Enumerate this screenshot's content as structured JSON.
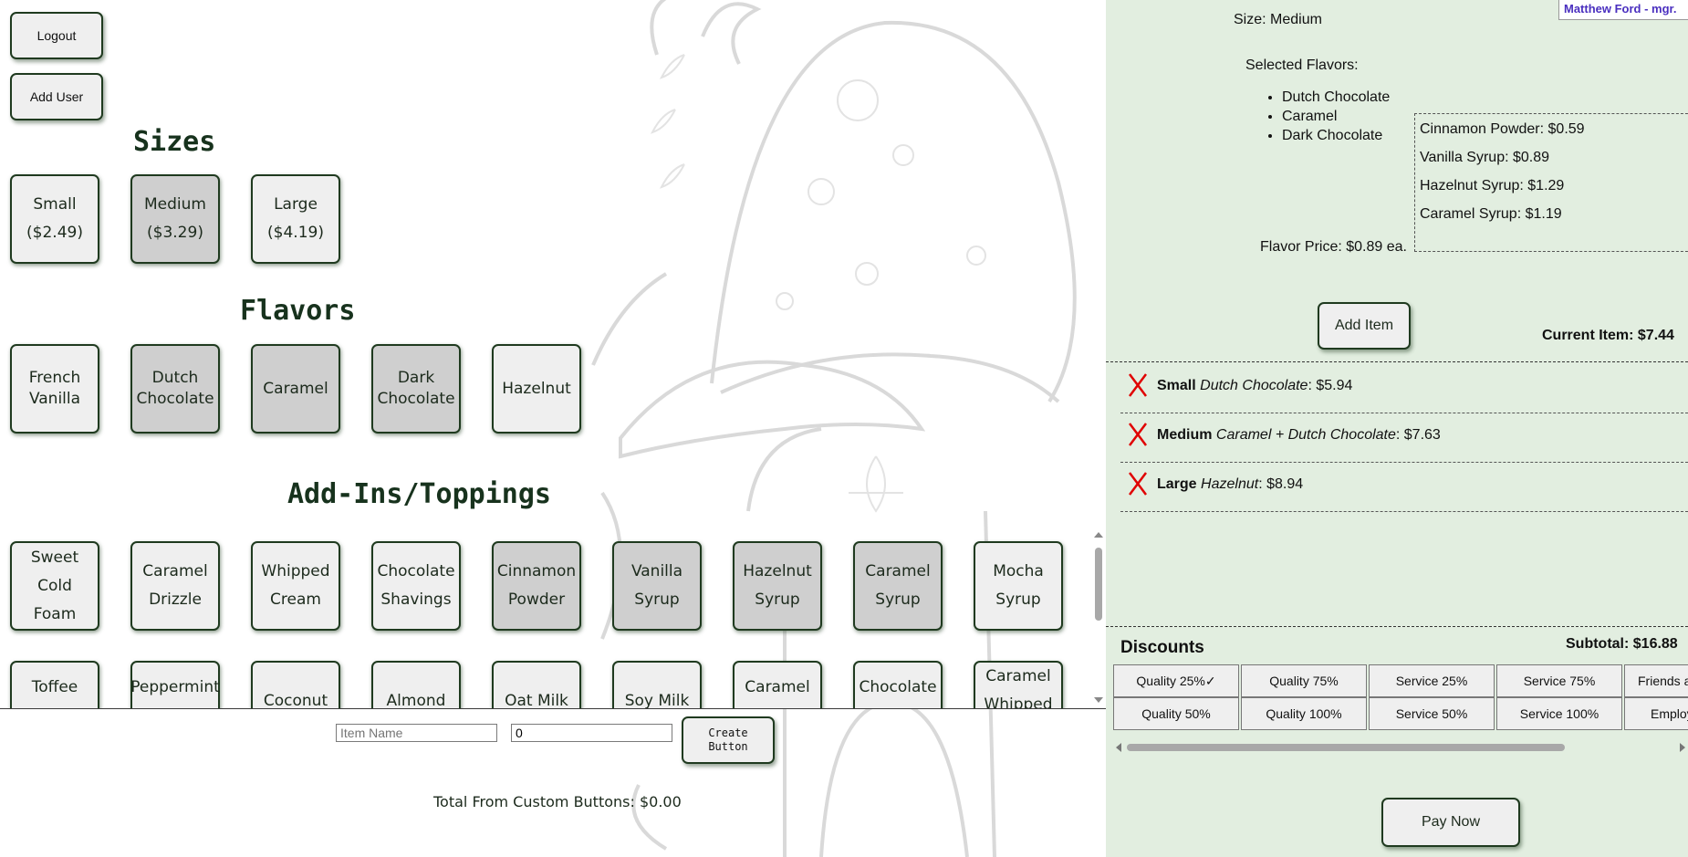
{
  "top_buttons": {
    "logout": "Logout",
    "add_user": "Add User"
  },
  "sizes": {
    "heading": "Sizes",
    "items": [
      {
        "name": "Small",
        "price": "($2.49)",
        "selected": false
      },
      {
        "name": "Medium",
        "price": "($3.29)",
        "selected": true
      },
      {
        "name": "Large",
        "price": "($4.19)",
        "selected": false
      }
    ]
  },
  "flavors": {
    "heading": "Flavors",
    "items": [
      {
        "l1": "French",
        "l2": "Vanilla",
        "selected": false
      },
      {
        "l1": "Dutch",
        "l2": "Chocolate",
        "selected": true
      },
      {
        "l1": "Caramel",
        "l2": "",
        "selected": true
      },
      {
        "l1": "Dark",
        "l2": "Chocolate",
        "selected": true
      },
      {
        "l1": "Hazelnut",
        "l2": "",
        "selected": false
      }
    ]
  },
  "addins": {
    "heading": "Add-Ins/Toppings",
    "row1": [
      {
        "l1": "Sweet Cold",
        "l2": "Foam",
        "selected": false
      },
      {
        "l1": "Caramel",
        "l2": "Drizzle",
        "selected": false
      },
      {
        "l1": "Whipped",
        "l2": "Cream",
        "selected": false
      },
      {
        "l1": "Chocolate",
        "l2": "Shavings",
        "selected": false
      },
      {
        "l1": "Cinnamon",
        "l2": "Powder",
        "selected": true
      },
      {
        "l1": "Vanilla",
        "l2": "Syrup",
        "selected": true
      },
      {
        "l1": "Hazelnut",
        "l2": "Syrup",
        "selected": true
      },
      {
        "l1": "Caramel",
        "l2": "Syrup",
        "selected": true
      },
      {
        "l1": "Mocha",
        "l2": "Syrup",
        "selected": false
      }
    ],
    "row2": [
      {
        "l1": "Toffee Nut",
        "l2": ""
      },
      {
        "l1": "Peppermint",
        "l2": ""
      },
      {
        "l1": "Coconut Milk",
        "l2": ""
      },
      {
        "l1": "Almond Milk",
        "l2": ""
      },
      {
        "l1": "Oat Milk",
        "l2": ""
      },
      {
        "l1": "Soy Milk",
        "l2": ""
      },
      {
        "l1": "Caramel",
        "l2": ""
      },
      {
        "l1": "Chocolate",
        "l2": ""
      },
      {
        "l1": "Caramel",
        "l2": "Whipped"
      }
    ]
  },
  "custom": {
    "name_placeholder": "Item Name",
    "price_value": "0",
    "create_l1": "Create",
    "create_l2": "Button",
    "total_text": "Total From Custom Buttons: $0.00"
  },
  "panel": {
    "user": "Matthew Ford - mgr.",
    "size_text": "Size: Medium",
    "selected_flavors_label": "Selected Flavors:",
    "selected_flavors": [
      "Dutch Chocolate",
      "Caramel",
      "Dark Chocolate"
    ],
    "addin_prices": [
      "Cinnamon Powder: $0.59",
      "Vanilla Syrup: $0.89",
      "Hazelnut Syrup: $1.29",
      "Caramel Syrup: $1.19"
    ],
    "flavor_price": "Flavor Price: $0.89 ea.",
    "add_item": "Add Item",
    "current_item": "Current Item: $7.44",
    "order_items": [
      {
        "size": "Small",
        "flavor": "Dutch Chocolate",
        "price": ": $5.94"
      },
      {
        "size": "Medium",
        "flavor": "Caramel + Dutch Chocolate",
        "price": ": $7.63"
      },
      {
        "size": "Large",
        "flavor": "Hazelnut",
        "price": ": $8.94"
      }
    ],
    "remove_glyph": "X",
    "discounts_label": "Discounts",
    "subtotal": "Subtotal: $16.88",
    "discounts_row1": [
      "Quality 25%✓",
      "Quality 75%",
      "Service 25%",
      "Service 75%",
      "Friends and"
    ],
    "discounts_row2": [
      "Quality 50%",
      "Quality 100%",
      "Service 50%",
      "Service 100%",
      "Employee"
    ],
    "pay_now": "Pay Now"
  },
  "colors": {
    "panel_bg": "#e2eee0",
    "selected_btn": "#cfcfcf",
    "remove_x": "#e00000",
    "user_text": "#4a2fbf"
  }
}
